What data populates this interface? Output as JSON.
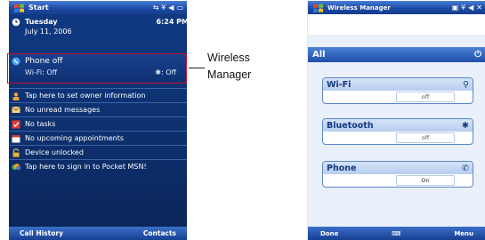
{
  "left_screen": {
    "title": "Start",
    "date_day": "Tuesday",
    "time": "6:24 PM",
    "date": "July 11, 2006",
    "phone_status": "Phone off",
    "wifi_status": "Wi-Fi: Off",
    "bluetooth_status": ": Off",
    "items": [
      {
        "label": "Tap here to set owner information",
        "icon": "owner-info-icon"
      },
      {
        "label": "No unread messages",
        "icon": "messages-icon"
      },
      {
        "label": "No tasks",
        "icon": "tasks-icon"
      },
      {
        "label": "No upcoming appointments",
        "icon": "calendar-icon"
      },
      {
        "label": "Device unlocked",
        "icon": "lock-icon"
      },
      {
        "label": "Tap here to sign in to Pocket MSN!",
        "icon": "msn-icon"
      }
    ],
    "softkey_left": "Call History",
    "softkey_right": "Contacts"
  },
  "callout": {
    "line1": "Wireless",
    "line2": "Manager"
  },
  "right_screen": {
    "title": "Wireless Manager",
    "all_label": "All",
    "wifi_label": "Wi-Fi",
    "wifi_state": "off",
    "bluetooth_label": "Bluetooth",
    "bluetooth_state": "off",
    "phone_label": "Phone",
    "phone_state": "On",
    "softkey_left": "Done",
    "softkey_right": "Menu"
  },
  "colors": {
    "highlight_border": "#c8102e",
    "title_blue": "#1d4aa6"
  }
}
